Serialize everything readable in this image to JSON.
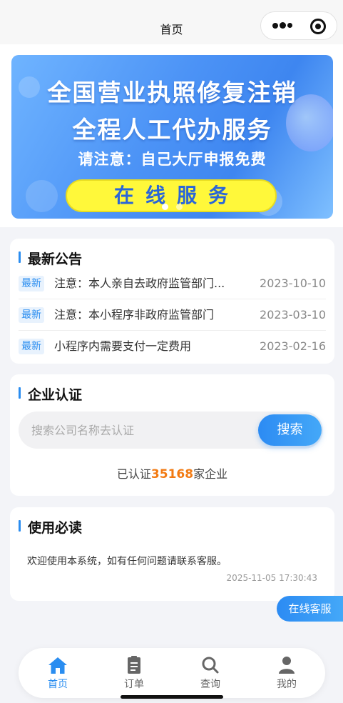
{
  "navbar": {
    "title": "首页"
  },
  "banner": {
    "line1": "全国营业执照修复注销",
    "line2": "全程人工代办服务",
    "line3": "请注意：自己大厅申报免费",
    "cta": "在线服务"
  },
  "notice": {
    "title": "最新公告",
    "items": [
      {
        "tag": "最新",
        "text": "注意：本人亲自去政府监管部门...",
        "date": "2023-10-10"
      },
      {
        "tag": "最新",
        "text": "注意：本小程序非政府监管部门",
        "date": "2023-03-10"
      },
      {
        "tag": "最新",
        "text": "小程序内需要支付一定费用",
        "date": "2023-02-16"
      }
    ]
  },
  "cert": {
    "title": "企业认证",
    "search_placeholder": "搜索公司名称去认证",
    "search_button": "搜索",
    "count_prefix": "已认证",
    "count_value": "35168",
    "count_suffix": "家企业"
  },
  "read": {
    "title": "使用必读",
    "text": "欢迎使用本系统，如有任何问题请联系客服。",
    "time": "2025-11-05 17:30:43"
  },
  "service_button": "在线客服",
  "tabbar": {
    "items": [
      {
        "label": "首页",
        "icon": "home-icon",
        "active": true
      },
      {
        "label": "订单",
        "icon": "order-icon",
        "active": false
      },
      {
        "label": "查询",
        "icon": "search-icon",
        "active": false
      },
      {
        "label": "我的",
        "icon": "user-icon",
        "active": false
      }
    ]
  },
  "colors": {
    "accent": "#2a8df0",
    "count_highlight": "#f27a12",
    "banner_cta_bg": "#fff83a"
  }
}
